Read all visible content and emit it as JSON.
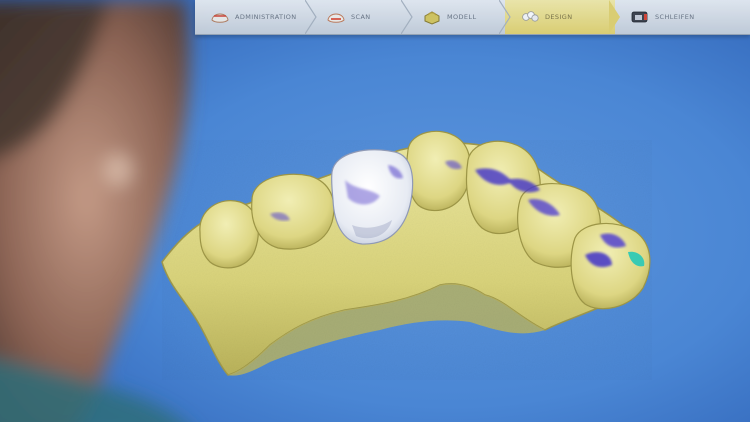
{
  "toolbar": {
    "steps": [
      {
        "label": "ADMINISTRATION",
        "icon": "jaw-arch-icon",
        "active": false
      },
      {
        "label": "SCAN",
        "icon": "scan-teeth-icon",
        "active": false
      },
      {
        "label": "MODELL",
        "icon": "model-block-icon",
        "active": false
      },
      {
        "label": "DESIGN",
        "icon": "crown-design-icon",
        "active": true
      },
      {
        "label": "SCHLEIFEN",
        "icon": "milling-machine-icon",
        "active": false
      }
    ]
  },
  "colors": {
    "background_blue": "#4a86d4",
    "toolbar_gray": "#d7dde4",
    "active_step_yellow": "#e8d877",
    "model_yellow": "#e4e08a",
    "crown_white": "#f0f2f6",
    "contact_blue": "#5a44c8",
    "contact_teal": "#2fc9b5"
  },
  "scene": {
    "subject": "dental CAD model of lower jaw arch with designed crown",
    "foreground": "blurred person viewing screen"
  }
}
